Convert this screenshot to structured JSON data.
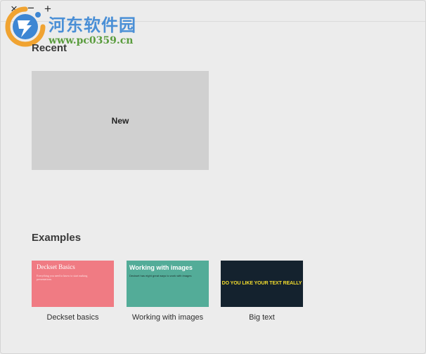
{
  "window": {
    "controls": {
      "close": "×",
      "minimize": "−",
      "maximize": "+"
    }
  },
  "watermark": {
    "title": "河东软件园",
    "url": "www.pc0359.cn"
  },
  "recent": {
    "heading": "Recent",
    "new_label": "New"
  },
  "examples": {
    "heading": "Examples",
    "items": [
      {
        "caption": "Deckset basics",
        "thumb_title": "Deckset Basics",
        "thumb_text": "Everything you need to know to start making presentations.",
        "color": "#f07b83"
      },
      {
        "caption": "Working with images",
        "thumb_title": "Working with images",
        "thumb_text": "Deckset has eight great ways to work with images",
        "color": "#53ac98"
      },
      {
        "caption": "Big text",
        "thumb_title": "DO YOU LIKE YOUR TEXT REALLY",
        "color": "#14222e",
        "text_color": "#f3dc2d"
      }
    ]
  }
}
